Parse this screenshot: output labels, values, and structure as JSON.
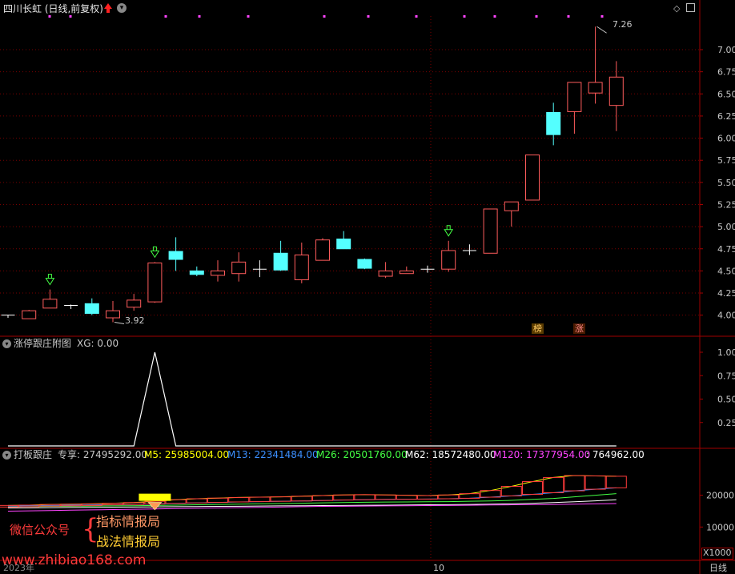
{
  "header": {
    "title": "四川长虹 (日线,前复权)",
    "settings_icon": "chevron-down-icon",
    "top_right_icons": [
      "diamond-icon",
      "window-icon"
    ]
  },
  "main_panel": {
    "ylim": [
      3.78,
      7.38
    ],
    "y_ticks": [
      "7.00",
      "6.75",
      "6.50",
      "6.25",
      "6.00",
      "5.75",
      "5.50",
      "5.25",
      "5.00",
      "4.75",
      "4.50",
      "4.25",
      "4.00"
    ],
    "y_tick_values": [
      7.0,
      6.75,
      6.5,
      6.25,
      6.0,
      5.75,
      5.5,
      5.25,
      5.0,
      4.75,
      4.5,
      4.25,
      4.0
    ],
    "high_label": "7.26",
    "low_label": "3.92",
    "tags": [
      "榜",
      "涨"
    ],
    "colors": {
      "up": "#ff5c5c",
      "down": "#54ffff",
      "neutral": "#ffffff",
      "marker": "#ff44ff",
      "arrow": "#44ff44",
      "grid": "#7a0000"
    }
  },
  "chart_data": [
    {
      "type": "candlestick",
      "title": "四川长虹 (日线,前复权)",
      "ylim": [
        3.78,
        7.38
      ],
      "candles": [
        {
          "o": 4.0,
          "h": 4.0,
          "l": 3.97,
          "c": 4.0,
          "d": "n"
        },
        {
          "o": 3.96,
          "h": 4.06,
          "l": 3.96,
          "c": 4.05,
          "d": "u"
        },
        {
          "o": 4.08,
          "h": 4.29,
          "l": 4.08,
          "c": 4.18,
          "d": "u"
        },
        {
          "o": 4.11,
          "h": 4.12,
          "l": 4.07,
          "c": 4.11,
          "d": "n"
        },
        {
          "o": 4.13,
          "h": 4.19,
          "l": 4.0,
          "c": 4.02,
          "d": "d"
        },
        {
          "o": 3.97,
          "h": 4.16,
          "l": 3.92,
          "c": 4.05,
          "d": "u"
        },
        {
          "o": 4.09,
          "h": 4.24,
          "l": 4.05,
          "c": 4.17,
          "d": "u"
        },
        {
          "o": 4.15,
          "h": 4.6,
          "l": 4.14,
          "c": 4.59,
          "d": "u"
        },
        {
          "o": 4.72,
          "h": 4.88,
          "l": 4.5,
          "c": 4.63,
          "d": "d"
        },
        {
          "o": 4.5,
          "h": 4.55,
          "l": 4.44,
          "c": 4.46,
          "d": "d"
        },
        {
          "o": 4.45,
          "h": 4.62,
          "l": 4.38,
          "c": 4.5,
          "d": "u"
        },
        {
          "o": 4.47,
          "h": 4.71,
          "l": 4.38,
          "c": 4.6,
          "d": "u"
        },
        {
          "o": 4.52,
          "h": 4.62,
          "l": 4.43,
          "c": 4.52,
          "d": "n"
        },
        {
          "o": 4.7,
          "h": 4.84,
          "l": 4.5,
          "c": 4.51,
          "d": "d"
        },
        {
          "o": 4.4,
          "h": 4.82,
          "l": 4.36,
          "c": 4.68,
          "d": "u"
        },
        {
          "o": 4.62,
          "h": 4.87,
          "l": 4.62,
          "c": 4.85,
          "d": "u"
        },
        {
          "o": 4.86,
          "h": 4.95,
          "l": 4.75,
          "c": 4.75,
          "d": "d"
        },
        {
          "o": 4.63,
          "h": 4.64,
          "l": 4.52,
          "c": 4.53,
          "d": "d"
        },
        {
          "o": 4.44,
          "h": 4.6,
          "l": 4.42,
          "c": 4.5,
          "d": "u"
        },
        {
          "o": 4.47,
          "h": 4.55,
          "l": 4.47,
          "c": 4.5,
          "d": "u"
        },
        {
          "o": 4.52,
          "h": 4.56,
          "l": 4.48,
          "c": 4.52,
          "d": "n"
        },
        {
          "o": 4.52,
          "h": 4.84,
          "l": 4.49,
          "c": 4.73,
          "d": "u"
        },
        {
          "o": 4.73,
          "h": 4.8,
          "l": 4.68,
          "c": 4.73,
          "d": "n"
        },
        {
          "o": 4.7,
          "h": 5.2,
          "l": 4.7,
          "c": 5.2,
          "d": "u"
        },
        {
          "o": 5.18,
          "h": 5.28,
          "l": 5.0,
          "c": 5.28,
          "d": "u"
        },
        {
          "o": 5.3,
          "h": 5.81,
          "l": 5.3,
          "c": 5.81,
          "d": "u"
        },
        {
          "o": 6.29,
          "h": 6.4,
          "l": 5.92,
          "c": 6.04,
          "d": "d"
        },
        {
          "o": 6.3,
          "h": 6.63,
          "l": 6.05,
          "c": 6.63,
          "d": "u"
        },
        {
          "o": 6.51,
          "h": 7.26,
          "l": 6.39,
          "c": 6.63,
          "d": "u"
        },
        {
          "o": 6.37,
          "h": 6.87,
          "l": 6.08,
          "c": 6.69,
          "d": "u"
        }
      ]
    },
    {
      "type": "line",
      "title": "涨停跟庄附图",
      "ylim": [
        0,
        1.0
      ],
      "y_ticks": [
        "1.00",
        "0.75",
        "0.50",
        "0.25"
      ],
      "y_tick_values": [
        1.0,
        0.75,
        0.5,
        0.25
      ],
      "values": [
        0,
        0,
        0,
        0,
        0,
        0,
        0,
        1,
        0,
        0,
        0,
        0,
        0,
        0,
        0,
        0,
        0,
        0,
        0,
        0,
        0,
        0,
        0,
        0,
        0,
        0,
        0,
        0,
        0,
        0
      ]
    },
    {
      "type": "line",
      "title": "打板跟庄",
      "ylim": [
        0,
        31000
      ],
      "y_ticks": [
        "20000",
        "10000"
      ],
      "y_tick_values": [
        20000,
        10000
      ],
      "series": [
        {
          "name": "M5",
          "values": [
            16800,
            16900,
            17100,
            17200,
            17300,
            17500,
            17700,
            18100,
            18600,
            18900,
            19100,
            19300,
            19400,
            19500,
            19700,
            19900,
            20100,
            20200,
            20100,
            20000,
            19900,
            20100,
            20500,
            21500,
            22800,
            24300,
            25600,
            26200,
            26100,
            25985
          ]
        },
        {
          "name": "M13",
          "values": [
            16600,
            16700,
            16800,
            16900,
            16950,
            17000,
            17100,
            17250,
            17450,
            17600,
            17750,
            17900,
            18000,
            18100,
            18200,
            18350,
            18500,
            18600,
            18700,
            18750,
            18800,
            18900,
            19050,
            19400,
            19800,
            20300,
            20800,
            21400,
            21900,
            22341
          ]
        },
        {
          "name": "M26",
          "values": [
            16300,
            16400,
            16500,
            16550,
            16600,
            16650,
            16700,
            16800,
            16900,
            17000,
            17100,
            17200,
            17300,
            17400,
            17500,
            17600,
            17700,
            17800,
            17850,
            17900,
            17950,
            18000,
            18100,
            18200,
            18400,
            18700,
            19000,
            19500,
            20000,
            20502
          ]
        },
        {
          "name": "M62",
          "values": [
            16000,
            16050,
            16100,
            16150,
            16200,
            16250,
            16300,
            16350,
            16400,
            16450,
            16500,
            16550,
            16600,
            16650,
            16700,
            16750,
            16800,
            16850,
            16900,
            16950,
            17000,
            17050,
            17100,
            17200,
            17300,
            17500,
            17700,
            17950,
            18250,
            18572
          ]
        },
        {
          "name": "M120",
          "values": [
            15000,
            15100,
            15200,
            15300,
            15400,
            15500,
            15600,
            15700,
            15800,
            15900,
            16000,
            16100,
            16200,
            16300,
            16400,
            16500,
            16550,
            16600,
            16650,
            16700,
            16750,
            16800,
            16850,
            16950,
            17000,
            17050,
            17100,
            17200,
            17300,
            17378
          ]
        }
      ]
    }
  ],
  "sub_panel": {
    "title": "涨停跟庄附图",
    "xg_label": "XG: 0.00"
  },
  "vol_panel": {
    "title": "打板跟庄",
    "label_main": "专享: 27495292.00",
    "label_m5": "M5: 25985004.00",
    "label_m13": "M13: 22341484.00",
    "label_m26": "M26: 20501760.00",
    "label_m62": "M62: 18572480.00",
    "label_m120": "M120: 17377954.00",
    "label_last": ": 764962.00",
    "colors": {
      "m5": "#ffff00",
      "m13": "#3b8fff",
      "m26": "#44ff44",
      "m62": "#ffffff",
      "m120": "#ff44ff"
    }
  },
  "watermark": {
    "line1_left": "微信公众号",
    "line1_right": "指标情报局",
    "line2_right": "战法情报局",
    "url": "www.zhibiao168.com"
  },
  "bottom": {
    "x_label_left": "2023年",
    "x_label_mid": "10",
    "scale_label": "X1000",
    "period_label": "日线"
  }
}
